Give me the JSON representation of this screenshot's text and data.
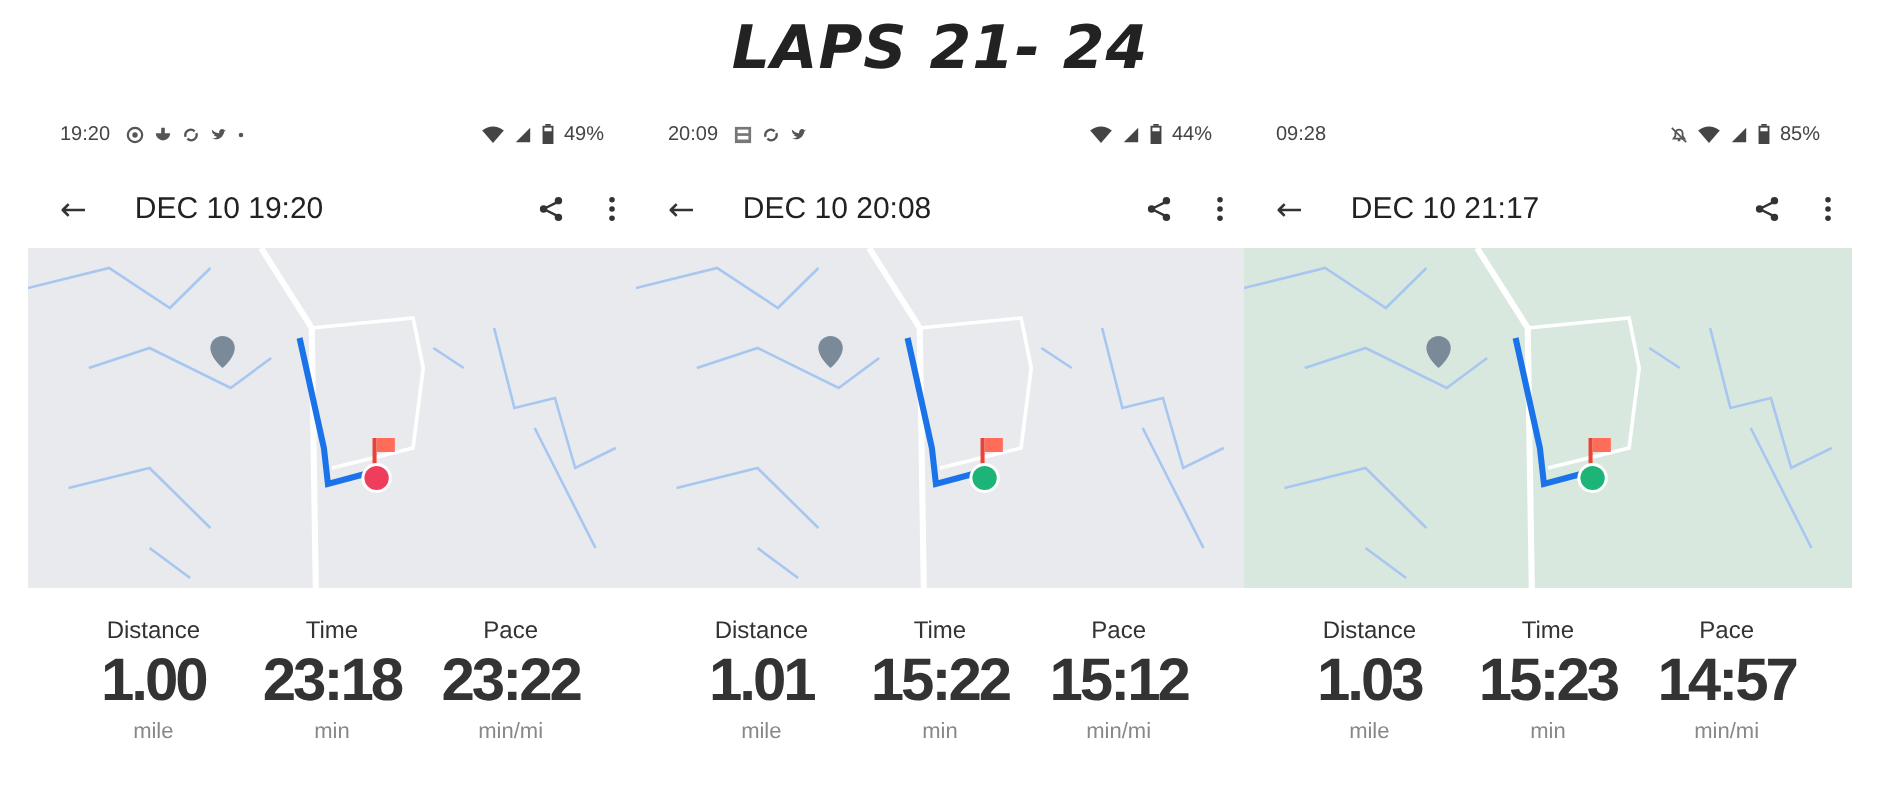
{
  "title": "LAPS 21- 24",
  "screens": [
    {
      "status": {
        "time": "19:20",
        "notifications": [
          {
            "kind": "chat"
          },
          {
            "kind": "bowl"
          },
          {
            "kind": "sync"
          },
          {
            "kind": "bird"
          },
          {
            "kind": "dot"
          }
        ],
        "silent": false,
        "battery_text": "49%"
      },
      "toolbar": {
        "back": "←",
        "date": "DEC 10 19:20"
      },
      "stats": [
        {
          "label": "Distance",
          "value": "1.00",
          "unit": "mile"
        },
        {
          "label": "Time",
          "value": "23:18",
          "unit": "min"
        },
        {
          "label": "Pace",
          "value": "23:22",
          "unit": "min/mi"
        }
      ]
    },
    {
      "status": {
        "time": "20:09",
        "notifications": [
          {
            "kind": "news"
          },
          {
            "kind": "sync"
          },
          {
            "kind": "bird"
          }
        ],
        "silent": false,
        "battery_text": "44%"
      },
      "toolbar": {
        "back": "←",
        "date": "DEC 10 20:08"
      },
      "stats": [
        {
          "label": "Distance",
          "value": "1.01",
          "unit": "mile"
        },
        {
          "label": "Time",
          "value": "15:22",
          "unit": "min"
        },
        {
          "label": "Pace",
          "value": "15:12",
          "unit": "min/mi"
        }
      ]
    },
    {
      "status": {
        "time": "09:28",
        "silent": true,
        "battery_text": "85%"
      },
      "toolbar": {
        "back": "←",
        "date": "DEC 10 21:17"
      },
      "stats": [
        {
          "label": "Distance",
          "value": "1.03",
          "unit": "mile"
        },
        {
          "label": "Time",
          "value": "15:23",
          "unit": "min"
        },
        {
          "label": "Pace",
          "value": "14:57",
          "unit": "min/mi"
        }
      ]
    }
  ]
}
